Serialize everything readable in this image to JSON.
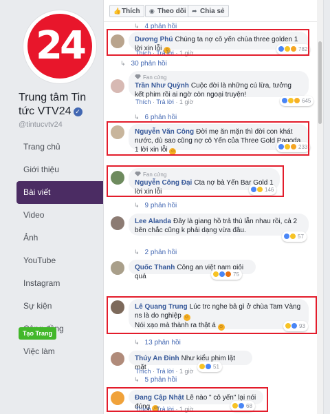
{
  "sidebar": {
    "logo_text": "24",
    "page_name": "Trung tâm Tin tức VTV24",
    "handle": "@tintucvtv24",
    "nav": [
      "Trang chủ",
      "Giới thiệu",
      "Bài viết",
      "Video",
      "Ảnh",
      "YouTube",
      "Instagram",
      "Sự kiện",
      "Cộng đồng",
      "Việc làm"
    ],
    "active_nav": "Bài viết",
    "create_page": "Tạo Trang"
  },
  "actions": {
    "like": "Thích",
    "follow": "Theo dõi",
    "share": "Chia sẻ"
  },
  "comment_actions": {
    "like": "Thích",
    "reply": "Trả lời",
    "time": "1 giờ"
  },
  "fan_label": "Fan cứng",
  "replies": {
    "r4": "4 phản hồi",
    "r30": "30 phản hồi",
    "r6": "6 phản hồi",
    "r9": "9 phản hồi",
    "r2": "2 phản hồi",
    "r13": "13 phản hồi",
    "r5": "5 phản hồi"
  },
  "comments": [
    {
      "name": "Dương Phú",
      "text": "Chúng ta nợ cô yến chùa three golden 1 lời xin lỗi",
      "count": "782"
    },
    {
      "name": "Trần Như Quỳnh",
      "text": "Cuộc đời là những cú lừa, tưởng kết phim rồi ai ngờ còn ngoại truyện!",
      "count": "645"
    },
    {
      "name": "Nguyễn Văn Công",
      "text": "Đời mẹ ăn mặn thì đời con khát nước, dù sao cũng nợ cô Yến của Three Gold Pagoda 1 lời xin lỗi",
      "count": "233"
    },
    {
      "name": "Nguyễn Công Đại",
      "text": "Cta nợ bà Yến Bar Gold 1 lời xin lỗi",
      "count": "146"
    },
    {
      "name": "Lee Alanda",
      "text": "Đây là giang hồ trả thù lẫn nhau rồi, cả 2 bên chắc cũng k phải dạng vừa đâu.",
      "count": "57"
    },
    {
      "name": "Quốc Thanh",
      "text": "Công an việt nam giỏi quá",
      "count": "75"
    },
    {
      "name": "Lê Quang Trung",
      "text": "Lúc trc nghe bả gì ở chùa Tam Vàng ns là do nghiệp",
      "text2": "Nói xạo mà thành ra thật á",
      "count": "93"
    },
    {
      "name": "Thúy An Đinh",
      "text": "Như kiểu phim lật mặt",
      "count": "51"
    },
    {
      "name": "Đang Cập Nhật",
      "text": "Lẽ nào \" cô yến\" lại nói đúng",
      "count": "68"
    }
  ],
  "colors": {
    "highlight": "#e31c2b",
    "link": "#365899",
    "active_nav": "#4b2c63"
  }
}
